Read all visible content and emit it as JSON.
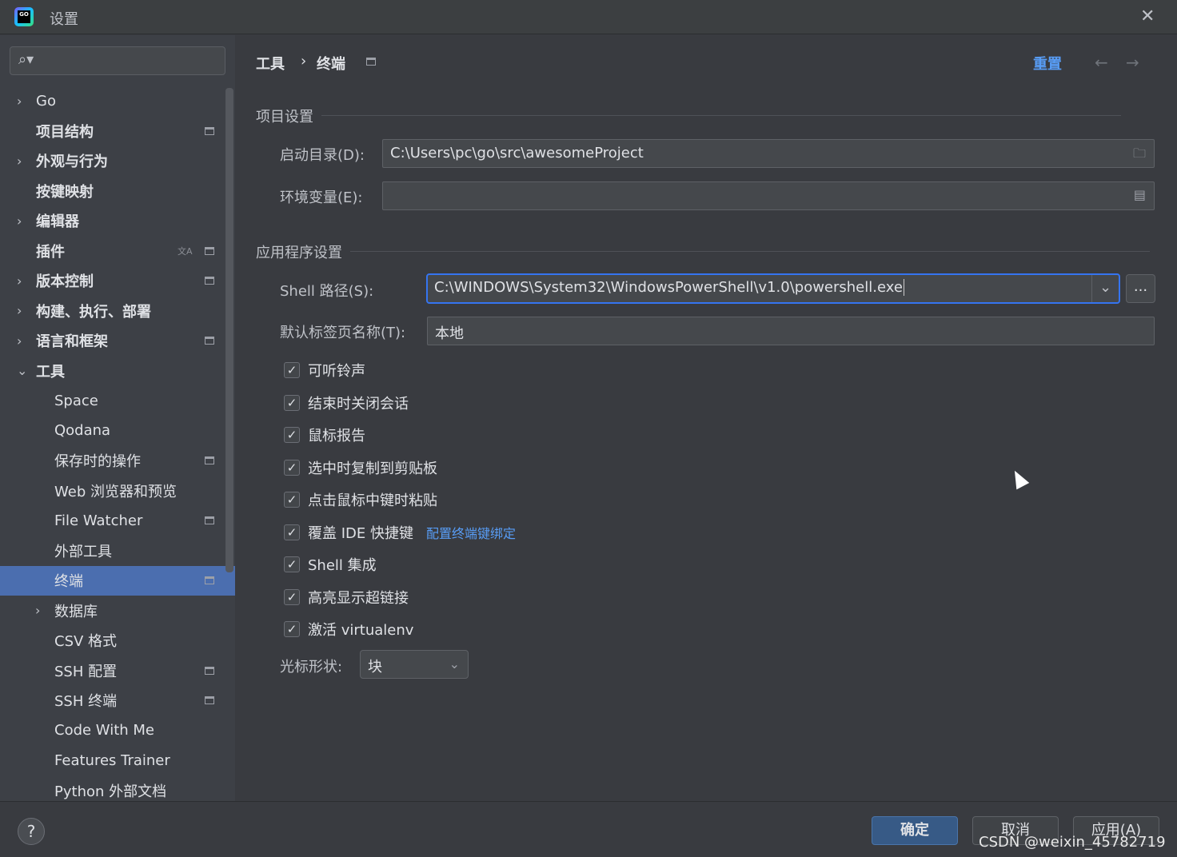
{
  "window": {
    "title": "设置",
    "logo_text": "GO"
  },
  "sidebar": {
    "search_placeholder": "",
    "items": [
      {
        "label": "Go",
        "arrow": "›",
        "level": 0,
        "page_icon": false
      },
      {
        "label": "项目结构",
        "arrow": "",
        "level": 0,
        "page_icon": true
      },
      {
        "label": "外观与行为",
        "arrow": "›",
        "level": 0,
        "page_icon": false
      },
      {
        "label": "按键映射",
        "arrow": "",
        "level": 0,
        "page_icon": false
      },
      {
        "label": "编辑器",
        "arrow": "›",
        "level": 0,
        "page_icon": false
      },
      {
        "label": "插件",
        "arrow": "",
        "level": 0,
        "page_icon": true,
        "translate_icon": true
      },
      {
        "label": "版本控制",
        "arrow": "›",
        "level": 0,
        "page_icon": true
      },
      {
        "label": "构建、执行、部署",
        "arrow": "›",
        "level": 0,
        "page_icon": false
      },
      {
        "label": "语言和框架",
        "arrow": "›",
        "level": 0,
        "page_icon": true
      },
      {
        "label": "工具",
        "arrow": "⌄",
        "level": 0,
        "page_icon": false
      },
      {
        "label": "Space",
        "arrow": "",
        "level": 1,
        "page_icon": false
      },
      {
        "label": "Qodana",
        "arrow": "",
        "level": 1,
        "page_icon": false
      },
      {
        "label": "保存时的操作",
        "arrow": "",
        "level": 1,
        "page_icon": true
      },
      {
        "label": "Web 浏览器和预览",
        "arrow": "",
        "level": 1,
        "page_icon": false
      },
      {
        "label": "File Watcher",
        "arrow": "",
        "level": 1,
        "page_icon": true
      },
      {
        "label": "外部工具",
        "arrow": "",
        "level": 1,
        "page_icon": false
      },
      {
        "label": "终端",
        "arrow": "",
        "level": 1,
        "page_icon": true,
        "selected": true
      },
      {
        "label": "数据库",
        "arrow": "›",
        "level": 1,
        "page_icon": false
      },
      {
        "label": "CSV 格式",
        "arrow": "",
        "level": 1,
        "page_icon": false
      },
      {
        "label": "SSH 配置",
        "arrow": "",
        "level": 1,
        "page_icon": true
      },
      {
        "label": "SSH 终端",
        "arrow": "",
        "level": 1,
        "page_icon": true
      },
      {
        "label": "Code With Me",
        "arrow": "",
        "level": 1,
        "page_icon": false
      },
      {
        "label": "Features Trainer",
        "arrow": "",
        "level": 1,
        "page_icon": false
      },
      {
        "label": "Python 外部文档",
        "arrow": "",
        "level": 1,
        "page_icon": false
      }
    ]
  },
  "header": {
    "breadcrumb": [
      "工具",
      "终端"
    ],
    "separator": "›",
    "reset": "重置"
  },
  "project": {
    "section": "项目设置",
    "start_dir_label": "启动目录(D):",
    "start_dir": "C:\\Users\\pc\\go\\src\\awesomeProject",
    "env_label": "环境变量(E):",
    "env": ""
  },
  "app": {
    "section": "应用程序设置",
    "shell_label": "Shell 路径(S):",
    "shell": "C:\\WINDOWS\\System32\\WindowsPowerShell\\v1.0\\powershell.exe",
    "browse": "...",
    "tab_name_label": "默认标签页名称(T):",
    "tab_name": "本地",
    "checkboxes": [
      {
        "label": "可听铃声",
        "checked": true
      },
      {
        "label": "结束时关闭会话",
        "checked": true
      },
      {
        "label": "鼠标报告",
        "checked": true
      },
      {
        "label": "选中时复制到剪贴板",
        "checked": true
      },
      {
        "label": "点击鼠标中键时粘贴",
        "checked": true
      },
      {
        "label": "覆盖 IDE 快捷键",
        "checked": true,
        "link": "配置终端键绑定"
      },
      {
        "label": "Shell 集成",
        "checked": true
      },
      {
        "label": "高亮显示超链接",
        "checked": true
      },
      {
        "label": "激活 virtualenv",
        "checked": true
      }
    ],
    "cursor_label": "光标形状:",
    "cursor_value": "块"
  },
  "footer": {
    "help": "?",
    "ok": "确定",
    "cancel": "取消",
    "apply": "应用(A)",
    "watermark": "CSDN @weixin_45782719"
  },
  "colors": {
    "accent": "#3574f0",
    "selected": "#4b6eaf",
    "link": "#589df6",
    "primary_button": "#375a86"
  }
}
